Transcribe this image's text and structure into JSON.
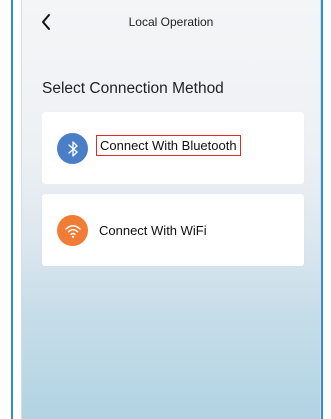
{
  "header": {
    "title": "Local Operation",
    "back_icon": "chevron-left-icon"
  },
  "main": {
    "section_title": "Select Connection Method",
    "options": [
      {
        "label": "Connect With Bluetooth",
        "icon": "bluetooth-icon",
        "icon_color": "#4a7fc7",
        "highlighted": true
      },
      {
        "label": "Connect With WiFi",
        "icon": "wifi-icon",
        "icon_color": "#f07c35",
        "highlighted": false
      }
    ]
  },
  "colors": {
    "highlight_border": "#e02b2b",
    "frame_accent": "#2f8fd6"
  }
}
